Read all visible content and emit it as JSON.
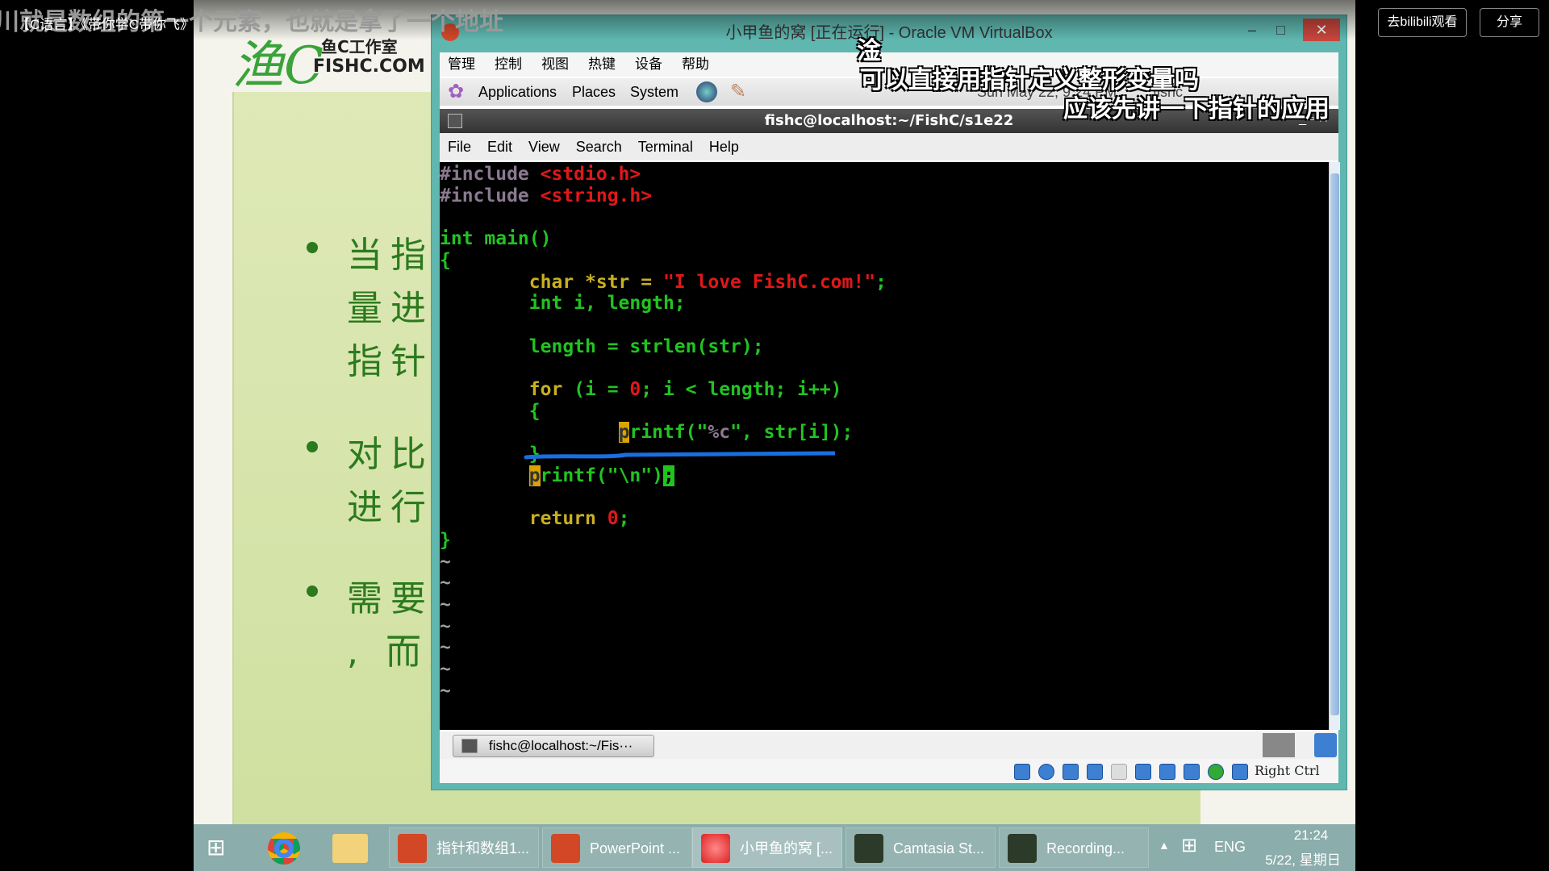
{
  "overlay": {
    "top_subtitle": "川就是数组的第一个元素，也就是拿了一个地址",
    "video_title": "【C语言】《带你学C带你飞》",
    "danmaku": [
      "淦",
      "可以直接用指针定义整形变量吗",
      "应该先讲一下指针的应用"
    ],
    "watch_button": "去bilibili观看",
    "share_button": "分享"
  },
  "slide": {
    "logo_text": "鱼C工作室",
    "logo_site": "FISHC.COM",
    "bullets": [
      [
        "当指针",
        "量进行",
        "指针所"
      ],
      [
        "对比标",
        "进行间"
      ],
      [
        "需要郑",
        ", 而是"
      ]
    ]
  },
  "vbox": {
    "title": "小甲鱼的窝 [正在运行] - Oracle VM VirtualBox",
    "menu": [
      "管理",
      "控制",
      "视图",
      "热键",
      "设备",
      "帮助"
    ],
    "gnome": {
      "items": [
        "Applications",
        "Places",
        "System"
      ],
      "clock": "Sun May 22,  9:24 PM",
      "user": "fishc"
    },
    "terminal": {
      "title": "fishc@localhost:~/FishC/s1e22",
      "menu": [
        "File",
        "Edit",
        "View",
        "Search",
        "Terminal",
        "Help"
      ]
    },
    "taskbar_item": "fishc@localhost:~/Fis···",
    "host_key": "Right Ctrl"
  },
  "code": {
    "l1a": "#include ",
    "l1b": "<stdio.h>",
    "l2a": "#include ",
    "l2b": "<string.h>",
    "l4": "int main()",
    "l5": "{",
    "l6a": "        char *str = ",
    "l6b": "\"I love FishC.com!\"",
    "l6c": ";",
    "l7": "        int i, length;",
    "l9": "        length = strlen(str);",
    "l11a": "        for ",
    "l11b": "(i = ",
    "l11c": "0",
    "l11d": "; i < length; i++)",
    "l12": "        {",
    "l13a": "                ",
    "l13b": "p",
    "l13c": "rintf(\"",
    "l13d": "%c",
    "l13e": "\", str[i]);",
    "l14": "        }",
    "l15a": "        ",
    "l15b": "p",
    "l15c": "rintf(\"\\n\")",
    "l15d": ";",
    "l17a": "        return ",
    "l17b": "0",
    "l17c": ";",
    "l18": "}",
    "tilde": "~"
  },
  "windows_taskbar": {
    "items": [
      "指针和数组1...",
      "PowerPoint ...",
      "小甲鱼的窝 [...",
      "Camtasia St...",
      "Recording..."
    ],
    "lang": "ENG",
    "time": "21:24",
    "date": "5/22, 星期日"
  },
  "colors": {
    "annotation": "#1a6fe0",
    "vbox_border": "#5fb7b0",
    "slide_green": "#2c7a1e"
  }
}
